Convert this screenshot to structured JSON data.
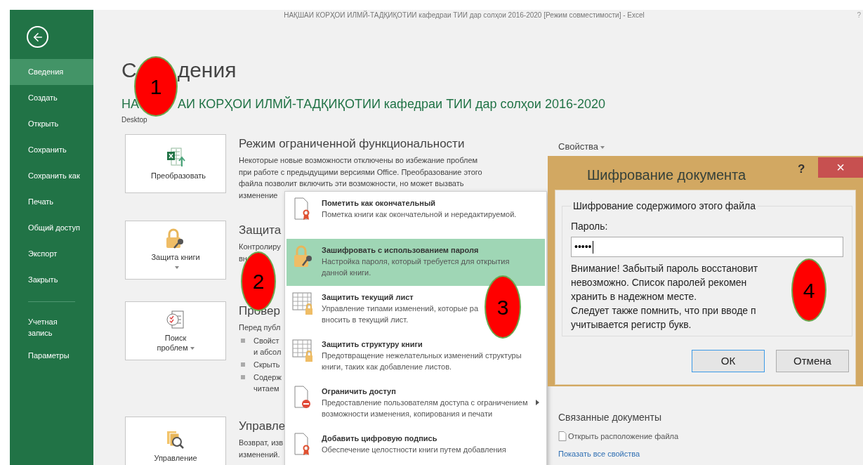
{
  "window": {
    "title": "НАҚШАИ КОРҲОИ ИЛМЙ-ТАДҚИҚОТИИ кафедраи ТИИ дар солҳои 2016-2020  [Режим совместимости] - Excel",
    "help": "?"
  },
  "sidebar": {
    "items": [
      {
        "label": "Сведения",
        "selected": true
      },
      {
        "label": "Создать",
        "selected": false
      },
      {
        "label": "Открыть",
        "selected": false
      },
      {
        "label": "Сохранить",
        "selected": false
      },
      {
        "label": "Сохранить как",
        "selected": false
      },
      {
        "label": "Печать",
        "selected": false
      },
      {
        "label": "Общий доступ",
        "selected": false
      },
      {
        "label": "Экспорт",
        "selected": false
      },
      {
        "label": "Закрыть",
        "selected": false
      }
    ],
    "bottom_items": [
      {
        "label": "Учетная запись",
        "selected": false
      },
      {
        "label": "Параметры",
        "selected": false
      }
    ]
  },
  "page": {
    "title": [
      "С",
      "дения"
    ],
    "document": [
      "НА",
      "АИ КОРҲОИ ИЛМЙ-ТАДҚИҚОТИИ кафедраи ТИИ дар солҳои 2016-2020"
    ],
    "location": "Desktop"
  },
  "sections": [
    {
      "kind": "convert",
      "button": "Преобразовать",
      "dropdown": false,
      "title": "Режим ограниченной функциональности",
      "lines": [
        "Некоторые новые возможности отключены во избежание проблем",
        "при работе с предыдущими версиями Office. Преобразование этого",
        "файла позволит включить эти возможности, но может вызвать",
        "изменение"
      ]
    },
    {
      "kind": "protect",
      "button": "Защита книги",
      "dropdown": true,
      "title": "Защита",
      "lines": [
        "Контролиру",
        "вн"
      ]
    },
    {
      "kind": "inspect",
      "button": "Поиск проблем",
      "dropdown": true,
      "title": "Провер",
      "lines": [
        "Перед публ"
      ],
      "bullets": [
        [
          "Свойст",
          "и абсол"
        ],
        [
          "Скрыть"
        ],
        [
          "Содерж",
          "читаем"
        ]
      ]
    },
    {
      "kind": "versions",
      "button": "Управление",
      "dropdown": false,
      "title": "Управле",
      "lines": [
        "Возврат, изв",
        "изменений."
      ]
    }
  ],
  "protect_menu": [
    {
      "kind": "final",
      "title": "Пометить как окончательный",
      "lines": [
        "Пометка книги как окончательной и нередактируемой."
      ],
      "selected": false,
      "submenu": false
    },
    {
      "kind": "password",
      "title": "Зашифровать с использованием пароля",
      "lines": [
        "Настройка пароля, который требуется для открытия",
        "данной книги."
      ],
      "selected": true,
      "submenu": false
    },
    {
      "kind": "sheet",
      "title": "Защитить текущий лист",
      "lines": [
        "Управление типами изменений, которые ра",
        "вносить в текущий лист."
      ],
      "selected": false,
      "submenu": false
    },
    {
      "kind": "sheet",
      "title": "Защитить структуру книги",
      "lines": [
        "Предотвращение нежелательных изменений структуры",
        "книги, таких как добавление листов."
      ],
      "selected": false,
      "submenu": false
    },
    {
      "kind": "restrict",
      "title": "Ограничить доступ",
      "lines": [
        "Предоставление пользователям доступа с ограничением",
        "возможности изменения, копирования и печати"
      ],
      "selected": false,
      "submenu": true
    },
    {
      "kind": "final",
      "title": "Добавить цифровую подпись",
      "lines": [
        "Обеспечение целостности книги путем добавления"
      ],
      "selected": false,
      "submenu": false
    }
  ],
  "properties": {
    "title": "Свойства",
    "related_title": "Связанные документы",
    "open_location": "Открыть расположение файла",
    "show_all": "Показать все свойства"
  },
  "dialog": {
    "title": "Шифрование документа",
    "help": "?",
    "close": "×",
    "group": "Шифрование содержимого этого файла",
    "password_label": "Пароль:",
    "password_value": "•••••",
    "warning": [
      "Внимание! Забытый пароль восстановит",
      "невозможно. Список паролей рекомен",
      "хранить в надежном месте.",
      "Следует также помнить, что при вводе п",
      "учитывается регистр букв."
    ],
    "ok": "ОК",
    "cancel": "Отмена"
  },
  "markers": [
    {
      "label": "1"
    },
    {
      "label": "2"
    },
    {
      "label": "3"
    },
    {
      "label": "4"
    }
  ]
}
